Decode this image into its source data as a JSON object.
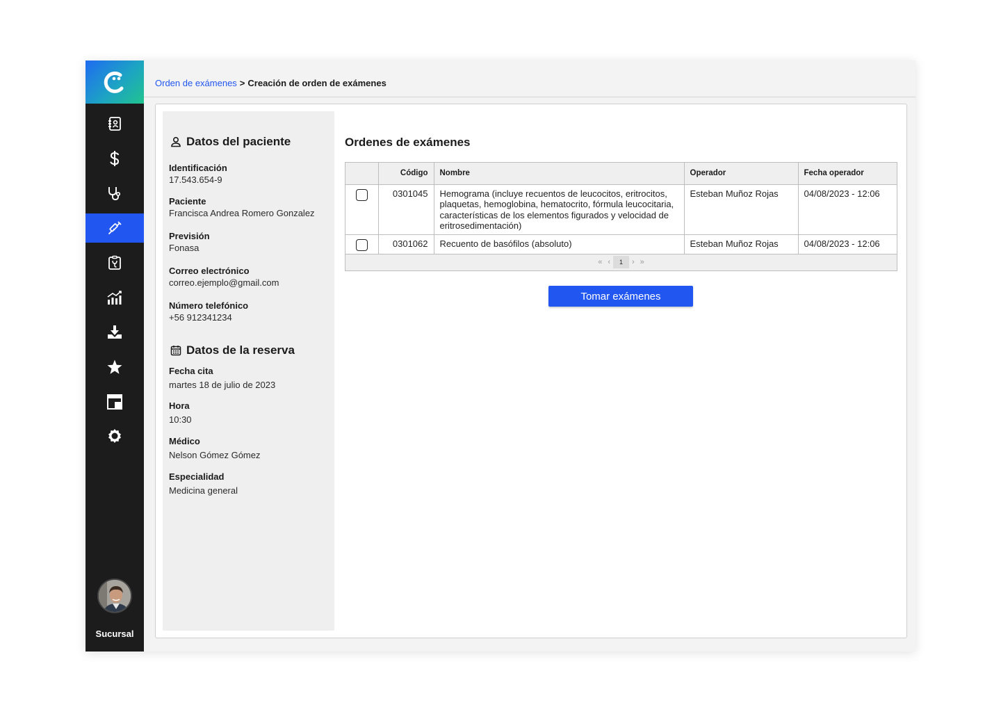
{
  "sidebar": {
    "items": [
      {
        "icon": "contacts-book-icon",
        "label": ""
      },
      {
        "icon": "dollar-icon",
        "label": ""
      },
      {
        "icon": "stethoscope-icon",
        "label": ""
      },
      {
        "icon": "syringe-icon",
        "label": ""
      },
      {
        "icon": "lab-report-icon",
        "label": ""
      },
      {
        "icon": "analytics-icon",
        "label": ""
      },
      {
        "icon": "download-icon",
        "label": ""
      },
      {
        "icon": "star-icon",
        "label": ""
      },
      {
        "icon": "windows-icon",
        "label": ""
      },
      {
        "icon": "settings-gear-icon",
        "label": ""
      }
    ],
    "active_index": 3,
    "branch_label": "Sucursal",
    "accent_color": "#2156f0"
  },
  "breadcrumb": {
    "link": "Orden de exámenes",
    "separator": ">",
    "current": "Creación de orden de exámenes"
  },
  "patient": {
    "section_title": "Datos del paciente",
    "fields": [
      {
        "label": "Identificación",
        "value": "17.543.654-9"
      },
      {
        "label": "Paciente",
        "value": "Francisca Andrea Romero Gonzalez"
      },
      {
        "label": "Previsión",
        "value": "Fonasa"
      },
      {
        "label": "Correo electrónico",
        "value": "correo.ejemplo@gmail.com"
      },
      {
        "label": "Número telefónico",
        "value": "+56 912341234"
      }
    ]
  },
  "reservation": {
    "section_title": "Datos de la reserva",
    "fields": [
      {
        "label": "Fecha cita",
        "value": "martes 18 de julio de 2023"
      },
      {
        "label": "Hora",
        "value": "10:30"
      },
      {
        "label": "Médico",
        "value": "Nelson Gómez Gómez"
      },
      {
        "label": "Especialidad",
        "value": "Medicina general"
      }
    ]
  },
  "orders": {
    "title": "Ordenes de exámenes",
    "columns": [
      "",
      "Código",
      "Nombre",
      "Operador",
      "Fecha operador"
    ],
    "rows": [
      {
        "checked": false,
        "code": "0301045",
        "name": "Hemograma (incluye recuentos de leucocitos, eritrocitos, plaquetas, hemoglobina, hematocrito, fórmula leucocitaria, características de los elementos figurados y velocidad de eritrosedimentación)",
        "operator": "Esteban Muñoz Rojas",
        "date": "04/08/2023 - 12:06"
      },
      {
        "checked": false,
        "code": "0301062",
        "name": "Recuento de basófilos (absoluto)",
        "operator": "Esteban Muñoz Rojas",
        "date": "04/08/2023 - 12:06"
      }
    ],
    "pagination": {
      "first": "«",
      "prev": "‹",
      "current": "1",
      "next": "›",
      "last": "»"
    },
    "action_label": "Tomar exámenes"
  }
}
